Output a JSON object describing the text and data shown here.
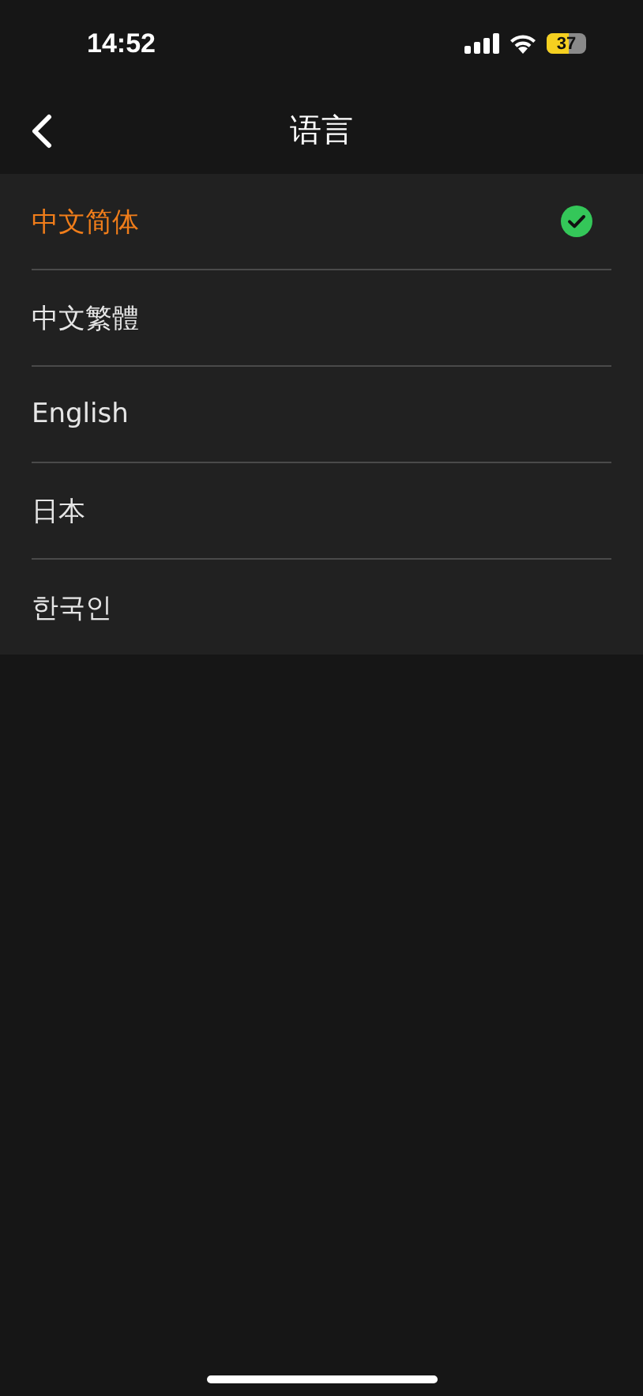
{
  "status_bar": {
    "time": "14:52",
    "battery": "37"
  },
  "header": {
    "title": "语言"
  },
  "languages": [
    {
      "label": "中文简体",
      "selected": true
    },
    {
      "label": "中文繁體",
      "selected": false
    },
    {
      "label": "English",
      "selected": false
    },
    {
      "label": "日本",
      "selected": false
    },
    {
      "label": "한국인",
      "selected": false
    }
  ]
}
